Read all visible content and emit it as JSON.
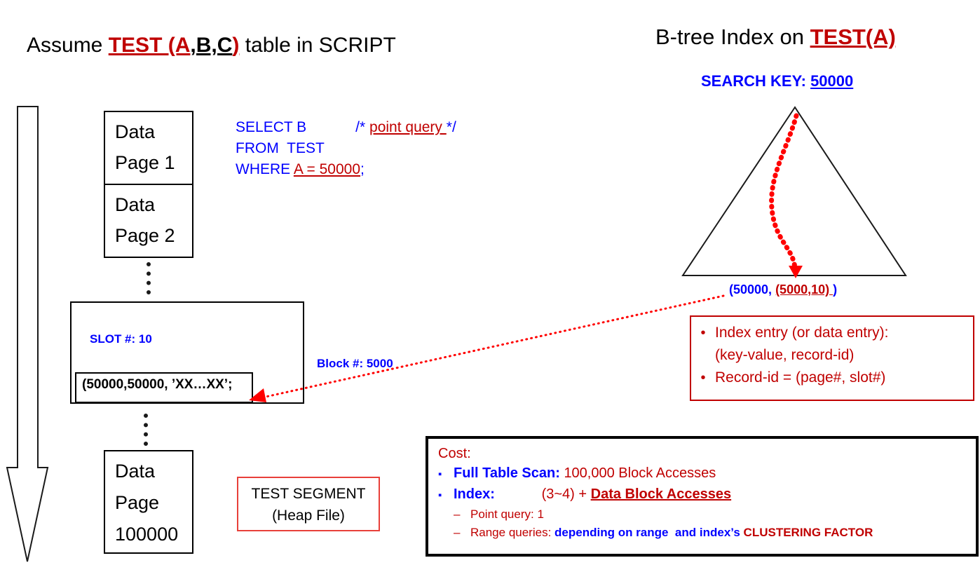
{
  "headings": {
    "left_pre": "Assume ",
    "left_table_red": "TEST (A",
    "left_table_black": ",B,C",
    "left_table_red2": ")",
    "left_post": " table in SCRIPT",
    "right_pre": "B-tree Index on ",
    "right_em": "TEST(A)",
    "search_key_label": "SEARCH KEY: ",
    "search_key_value": "50000"
  },
  "sql": {
    "line1_kw": "SELECT B",
    "line1_gap": "            ",
    "comment_open": "/* ",
    "comment_text": "point query ",
    "comment_close": "*/",
    "line2": "FROM  TEST",
    "line3_kw": "WHERE ",
    "line3_pred": "A = 50000",
    "line3_end": ";"
  },
  "heap": {
    "page_1_l1": "Data",
    "page_1_l2": "Page 1",
    "page_2_l1": "Data",
    "page_2_l2": "Page 2",
    "page_last_l1": "Data",
    "page_last_l2": "Page",
    "page_last_l3": "100000",
    "slot_label": "SLOT #: 10",
    "record_text": "(50000,50000, ’XX…XX’;",
    "block_label": "Block #: 5000",
    "segment_l1": "TEST SEGMENT",
    "segment_l2": "(Heap File)"
  },
  "index": {
    "entry_key": "(50000, ",
    "entry_rid": "(5000,10) ",
    "entry_close": ")",
    "info": {
      "bullet_1_line_1": "Index entry (or data entry):",
      "bullet_1_line_2": "(key-value, record-id)",
      "bullet_2": "Record-id = (page#, slot#)",
      "bullet_glyph": "•"
    }
  },
  "cost": {
    "title": "Cost:",
    "bullet_glyph": "▪",
    "dash_glyph": "–",
    "rows": [
      {
        "label": "Full Table Scan: ",
        "value": "100,000 Block Accesses"
      },
      {
        "label": "Index:            ",
        "value": "(3~4) + ",
        "value_em": "Data Block Accesses"
      }
    ],
    "subrows": [
      {
        "red": "Point query: 1"
      },
      {
        "red": "Range queries: ",
        "blue": "depending on range  and index’s ",
        "redb": "CLUSTERING FACTOR"
      }
    ]
  },
  "colors": {
    "blue": "#0000ff",
    "red": "#c00000",
    "segment_border": "#e8403a",
    "arrow_red": "#ff0000",
    "black": "#000000"
  }
}
